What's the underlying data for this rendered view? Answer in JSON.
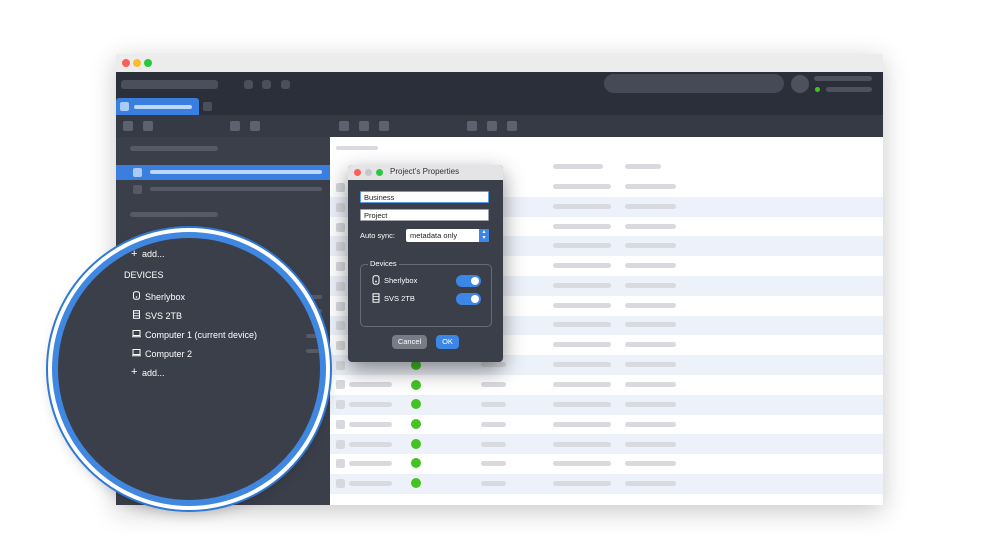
{
  "dialog": {
    "title": "Project's Properties",
    "field1_value": "Business",
    "field2_value": "Project",
    "autosync_label": "Auto sync:",
    "autosync_value": "metadata only",
    "devices_legend": "Devices",
    "devices": [
      {
        "name": "Sherlybox",
        "icon": "box-icon",
        "enabled": true
      },
      {
        "name": "SVS 2TB",
        "icon": "server-icon",
        "enabled": true
      }
    ],
    "cancel_label": "Cancel",
    "ok_label": "OK"
  },
  "sidebar": {
    "add_label_1": "add...",
    "devices_header": "DEVICES",
    "devices": [
      {
        "name": "Sherlybox",
        "icon": "box-icon"
      },
      {
        "name": "SVS 2TB",
        "icon": "server-icon"
      },
      {
        "name": "Computer 1 (current device)",
        "icon": "laptop-icon"
      },
      {
        "name": "Computer 2",
        "icon": "laptop-icon"
      }
    ],
    "add_label_2": "add..."
  },
  "colors": {
    "accent": "#3c86e6",
    "sidebar_bg": "#3b3f4a",
    "topbar_bg": "#2b2f39",
    "status_green": "#44c323",
    "row_alt": "#edf1f9"
  }
}
